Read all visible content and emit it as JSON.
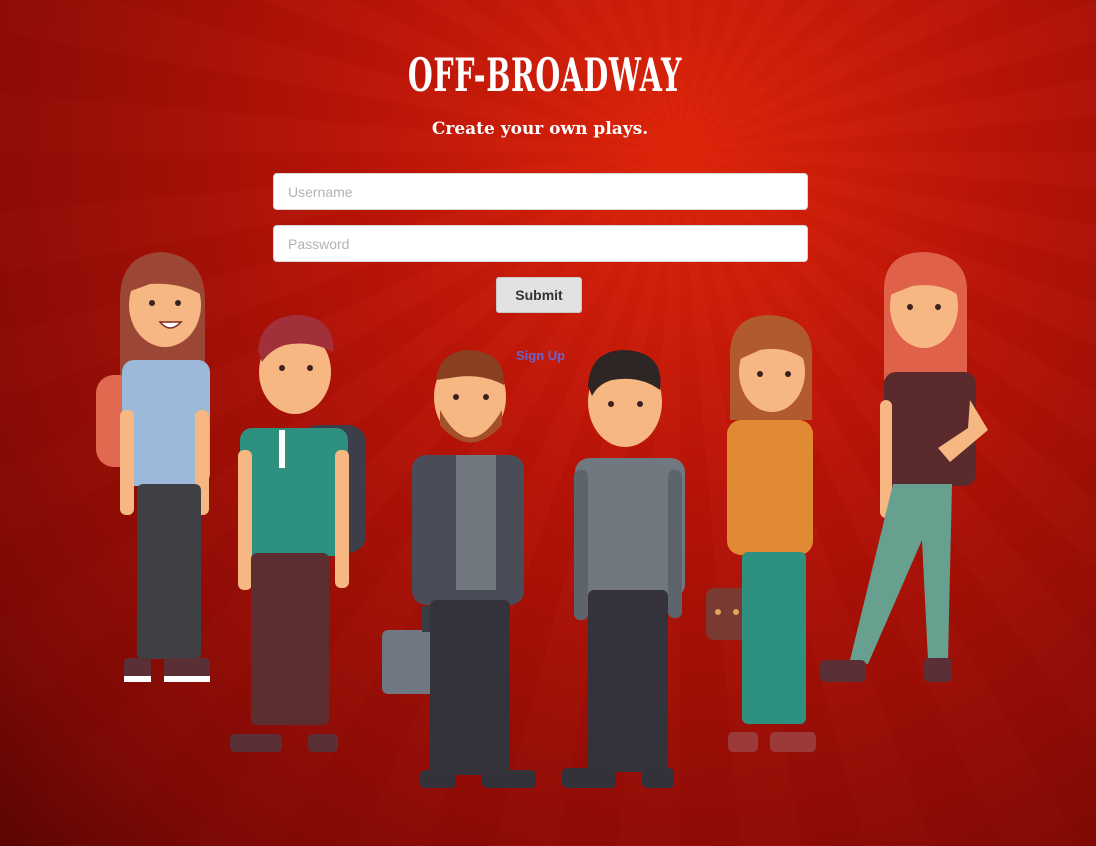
{
  "brand": {
    "logo": "OFF-BROADWAY",
    "tagline": "Create your own plays."
  },
  "login": {
    "username_placeholder": "Username",
    "password_placeholder": "Password",
    "submit_label": "Submit",
    "signup_label": "Sign Up"
  },
  "colors": {
    "background": "#b01206",
    "link": "#6b63c9"
  },
  "illustration": {
    "people": [
      "woman-backpack",
      "man-backpack",
      "bearded-man-briefcase",
      "man-grey-shirt",
      "woman-orange-top",
      "woman-red-hair"
    ]
  }
}
